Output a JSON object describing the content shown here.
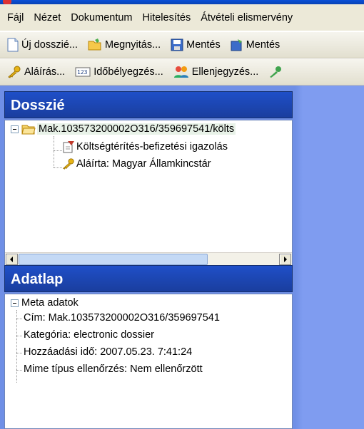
{
  "menu": [
    {
      "label": "Fájl"
    },
    {
      "label": "Nézet"
    },
    {
      "label": "Dokumentum"
    },
    {
      "label": "Hitelesítés"
    },
    {
      "label": "Átvételi elismervény"
    }
  ],
  "toolbar1": {
    "new": "Új dosszié...",
    "open": "Megnyitás...",
    "save": "Mentés",
    "save2": "Mentés"
  },
  "toolbar2": {
    "sign": "Aláírás...",
    "timestamp": "Időbélyegzés...",
    "countersign": "Ellenjegyzés..."
  },
  "dossier": {
    "title": "Dosszié",
    "root": "Mak.103573200002O316/359697541/költs",
    "children": [
      "Költségtérítés-befizetési igazolás",
      "Aláírta: Magyar Államkincstár"
    ]
  },
  "datasheet": {
    "title": "Adatlap",
    "root": "Meta adatok",
    "rows": [
      "Cím: Mak.103573200002O316/359697541",
      "Kategória: electronic dossier",
      "Hozzáadási idő: 2007.05.23. 7:41:24",
      "Mime típus ellenőrzés: Nem ellenőrzött"
    ]
  },
  "colors": {
    "panel_header": "#1f4fc8",
    "background_pane": "#7f9cf0"
  }
}
